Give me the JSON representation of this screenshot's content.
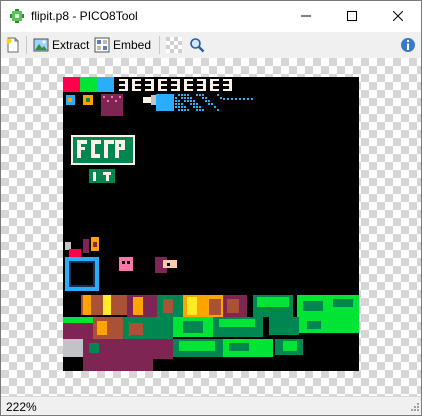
{
  "window": {
    "title": "flipit.p8 - PICO8Tool",
    "minimize_glyph": "—",
    "maximize_glyph": "☐",
    "close_glyph": "✕"
  },
  "toolbar": {
    "extract_label": "Extract",
    "embed_label": "Embed"
  },
  "statusbar": {
    "zoom": "222%"
  },
  "colors": {
    "pico_black": "#000000",
    "pico_darkblue": "#1d2b53",
    "pico_darkpurple": "#7e2553",
    "pico_darkgreen": "#008751",
    "pico_brown": "#ab5236",
    "pico_darkgray": "#5f574f",
    "pico_lightgray": "#c2c3c7",
    "pico_white": "#fff1e8",
    "pico_red": "#ff004d",
    "pico_orange": "#ffa300",
    "pico_yellow": "#ffec27",
    "pico_green": "#00e436",
    "pico_blue": "#29adff",
    "pico_indigo": "#83769c",
    "pico_pink": "#ff77a8",
    "pico_peach": "#ffccaa"
  },
  "icons": [
    "pico8-app-icon",
    "new-file-icon",
    "extract-picture-icon",
    "embed-icon",
    "palette-icon",
    "zoom-icon",
    "info-icon"
  ]
}
